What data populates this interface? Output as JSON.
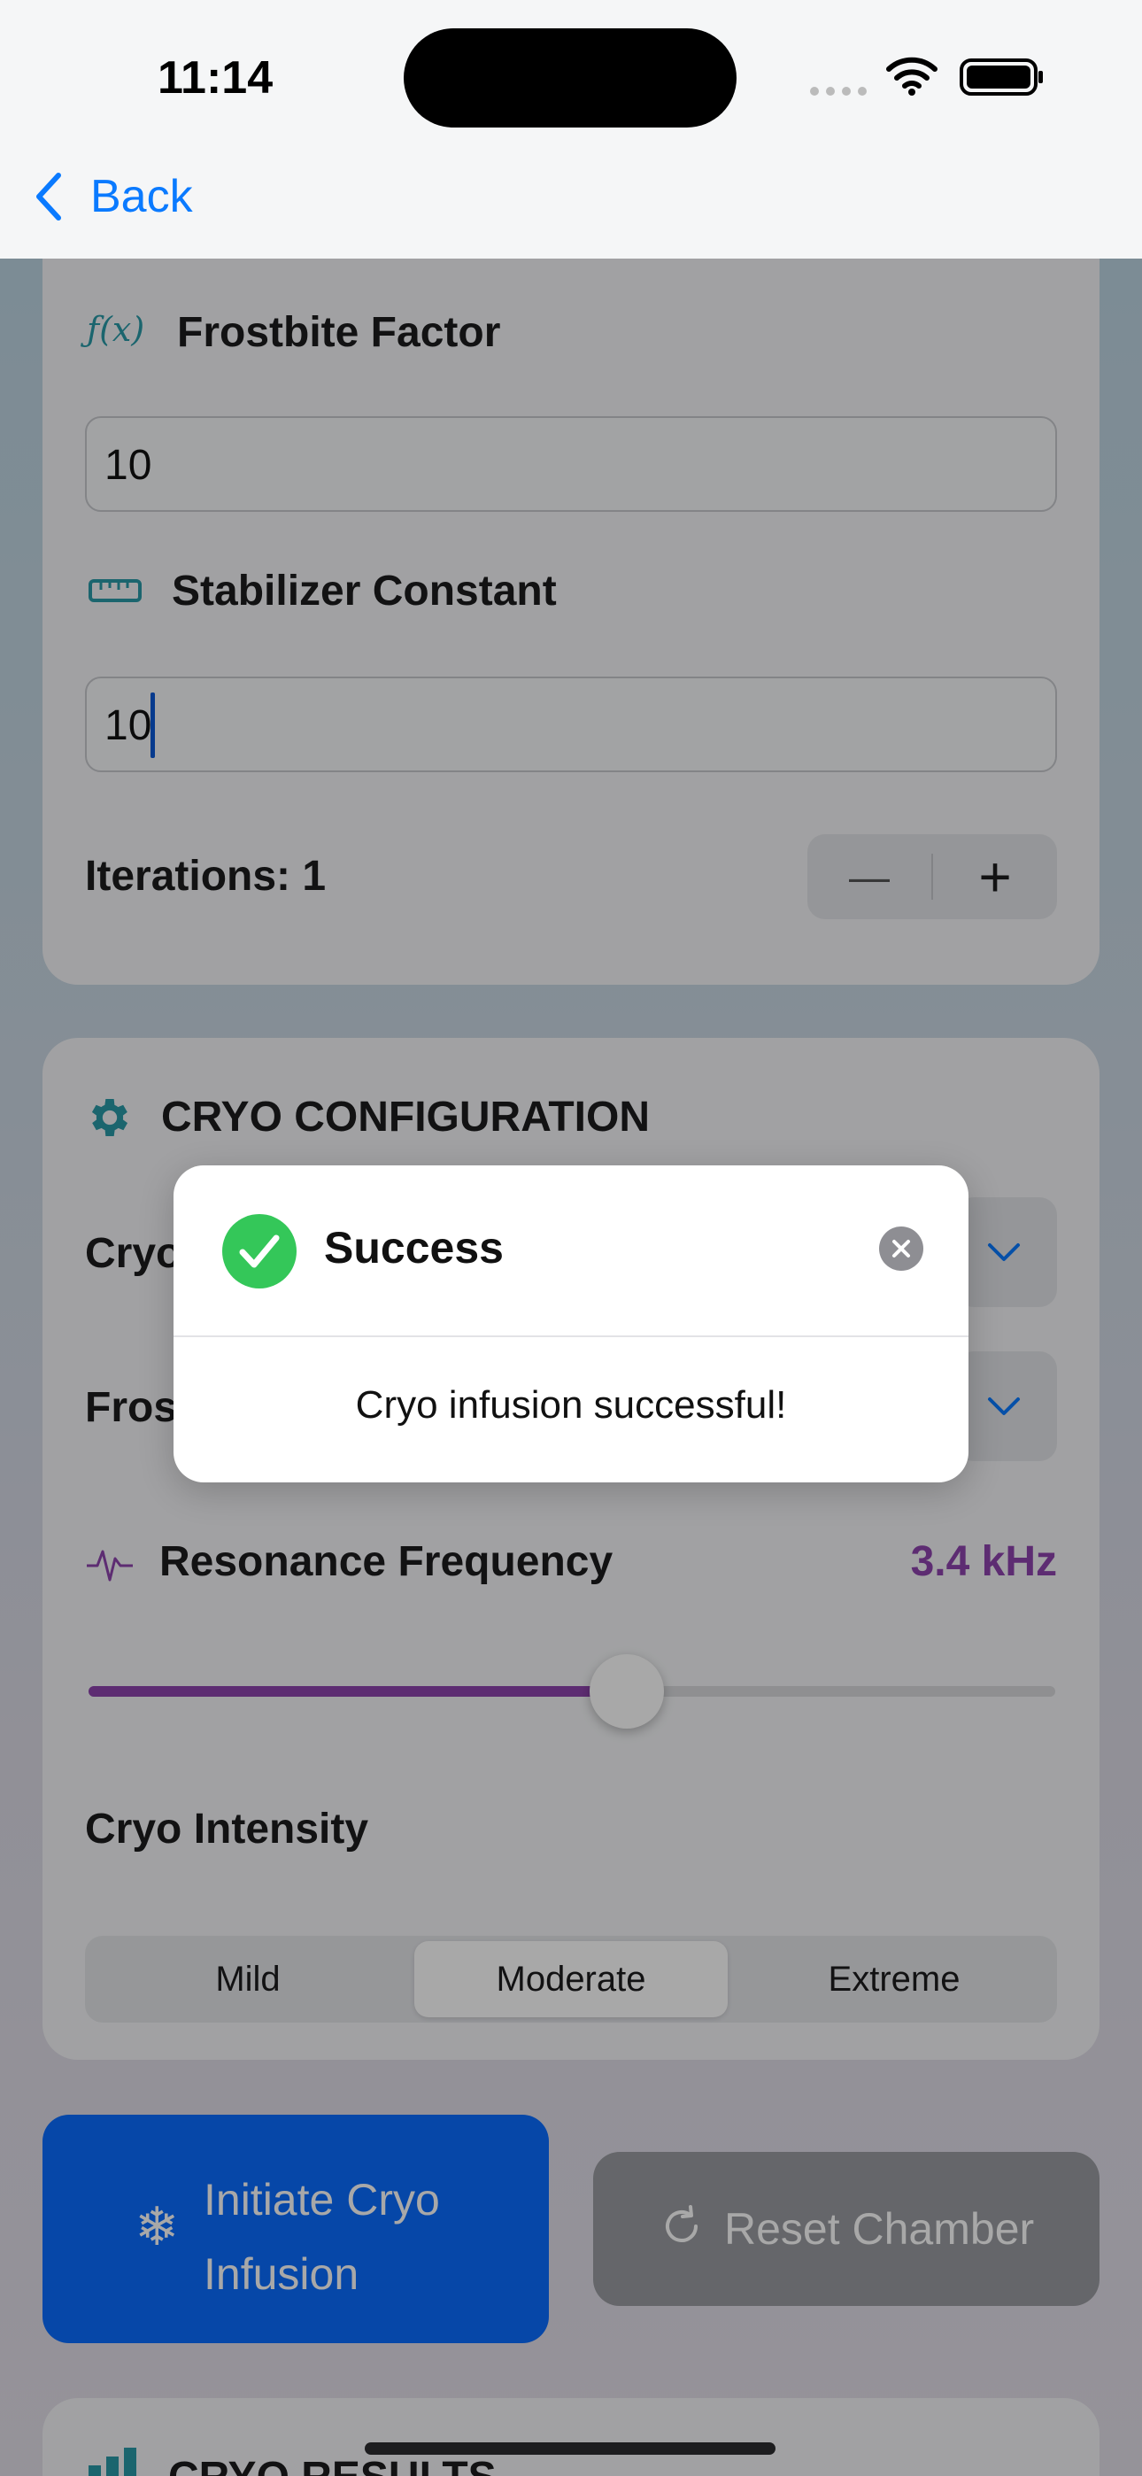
{
  "status_bar": {
    "time": "11:14"
  },
  "nav": {
    "back_label": "Back"
  },
  "inputs": {
    "frostbite": {
      "label": "Frostbite Factor",
      "value": "10"
    },
    "stabilizer": {
      "label": "Stabilizer Constant",
      "value": "10"
    },
    "iterations_label": "Iterations: 1",
    "stepper": {
      "minus": "—",
      "plus": "+"
    }
  },
  "config": {
    "title": "CRYO CONFIGURATION",
    "picker1_label": "Cryo",
    "picker2_label": "Fros",
    "resonance": {
      "label": "Resonance Frequency",
      "value": "3.4 kHz",
      "fraction": 0.557
    },
    "intensity": {
      "label": "Cryo Intensity",
      "options": [
        "Mild",
        "Moderate",
        "Extreme"
      ],
      "selected": "Moderate"
    }
  },
  "actions": {
    "initiate_line1": "Initiate Cryo",
    "initiate_line2": "Infusion",
    "reset": "Reset Chamber"
  },
  "results": {
    "title": "CRYO RESULTS"
  },
  "modal": {
    "title": "Success",
    "message": "Cryo infusion successful!"
  },
  "colors": {
    "accent": "#0a6cff",
    "purple": "#8e44ad",
    "teal": "#2a9aa8",
    "success": "#34c759"
  }
}
